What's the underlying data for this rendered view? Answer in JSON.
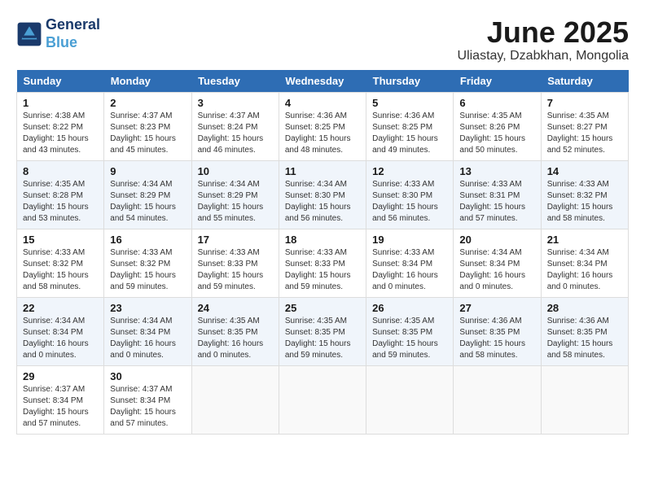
{
  "header": {
    "logo_line1": "General",
    "logo_line2": "Blue",
    "month_title": "June 2025",
    "location": "Uliastay, Dzabkhan, Mongolia"
  },
  "days_of_week": [
    "Sunday",
    "Monday",
    "Tuesday",
    "Wednesday",
    "Thursday",
    "Friday",
    "Saturday"
  ],
  "weeks": [
    [
      {
        "num": "1",
        "rise": "4:38 AM",
        "set": "8:22 PM",
        "daylight": "15 hours and 43 minutes."
      },
      {
        "num": "2",
        "rise": "4:37 AM",
        "set": "8:23 PM",
        "daylight": "15 hours and 45 minutes."
      },
      {
        "num": "3",
        "rise": "4:37 AM",
        "set": "8:24 PM",
        "daylight": "15 hours and 46 minutes."
      },
      {
        "num": "4",
        "rise": "4:36 AM",
        "set": "8:25 PM",
        "daylight": "15 hours and 48 minutes."
      },
      {
        "num": "5",
        "rise": "4:36 AM",
        "set": "8:25 PM",
        "daylight": "15 hours and 49 minutes."
      },
      {
        "num": "6",
        "rise": "4:35 AM",
        "set": "8:26 PM",
        "daylight": "15 hours and 50 minutes."
      },
      {
        "num": "7",
        "rise": "4:35 AM",
        "set": "8:27 PM",
        "daylight": "15 hours and 52 minutes."
      }
    ],
    [
      {
        "num": "8",
        "rise": "4:35 AM",
        "set": "8:28 PM",
        "daylight": "15 hours and 53 minutes."
      },
      {
        "num": "9",
        "rise": "4:34 AM",
        "set": "8:29 PM",
        "daylight": "15 hours and 54 minutes."
      },
      {
        "num": "10",
        "rise": "4:34 AM",
        "set": "8:29 PM",
        "daylight": "15 hours and 55 minutes."
      },
      {
        "num": "11",
        "rise": "4:34 AM",
        "set": "8:30 PM",
        "daylight": "15 hours and 56 minutes."
      },
      {
        "num": "12",
        "rise": "4:33 AM",
        "set": "8:30 PM",
        "daylight": "15 hours and 56 minutes."
      },
      {
        "num": "13",
        "rise": "4:33 AM",
        "set": "8:31 PM",
        "daylight": "15 hours and 57 minutes."
      },
      {
        "num": "14",
        "rise": "4:33 AM",
        "set": "8:32 PM",
        "daylight": "15 hours and 58 minutes."
      }
    ],
    [
      {
        "num": "15",
        "rise": "4:33 AM",
        "set": "8:32 PM",
        "daylight": "15 hours and 58 minutes."
      },
      {
        "num": "16",
        "rise": "4:33 AM",
        "set": "8:32 PM",
        "daylight": "15 hours and 59 minutes."
      },
      {
        "num": "17",
        "rise": "4:33 AM",
        "set": "8:33 PM",
        "daylight": "15 hours and 59 minutes."
      },
      {
        "num": "18",
        "rise": "4:33 AM",
        "set": "8:33 PM",
        "daylight": "15 hours and 59 minutes."
      },
      {
        "num": "19",
        "rise": "4:33 AM",
        "set": "8:34 PM",
        "daylight": "16 hours and 0 minutes."
      },
      {
        "num": "20",
        "rise": "4:34 AM",
        "set": "8:34 PM",
        "daylight": "16 hours and 0 minutes."
      },
      {
        "num": "21",
        "rise": "4:34 AM",
        "set": "8:34 PM",
        "daylight": "16 hours and 0 minutes."
      }
    ],
    [
      {
        "num": "22",
        "rise": "4:34 AM",
        "set": "8:34 PM",
        "daylight": "16 hours and 0 minutes."
      },
      {
        "num": "23",
        "rise": "4:34 AM",
        "set": "8:34 PM",
        "daylight": "16 hours and 0 minutes."
      },
      {
        "num": "24",
        "rise": "4:35 AM",
        "set": "8:35 PM",
        "daylight": "16 hours and 0 minutes."
      },
      {
        "num": "25",
        "rise": "4:35 AM",
        "set": "8:35 PM",
        "daylight": "15 hours and 59 minutes."
      },
      {
        "num": "26",
        "rise": "4:35 AM",
        "set": "8:35 PM",
        "daylight": "15 hours and 59 minutes."
      },
      {
        "num": "27",
        "rise": "4:36 AM",
        "set": "8:35 PM",
        "daylight": "15 hours and 58 minutes."
      },
      {
        "num": "28",
        "rise": "4:36 AM",
        "set": "8:35 PM",
        "daylight": "15 hours and 58 minutes."
      }
    ],
    [
      {
        "num": "29",
        "rise": "4:37 AM",
        "set": "8:34 PM",
        "daylight": "15 hours and 57 minutes."
      },
      {
        "num": "30",
        "rise": "4:37 AM",
        "set": "8:34 PM",
        "daylight": "15 hours and 57 minutes."
      },
      null,
      null,
      null,
      null,
      null
    ]
  ]
}
